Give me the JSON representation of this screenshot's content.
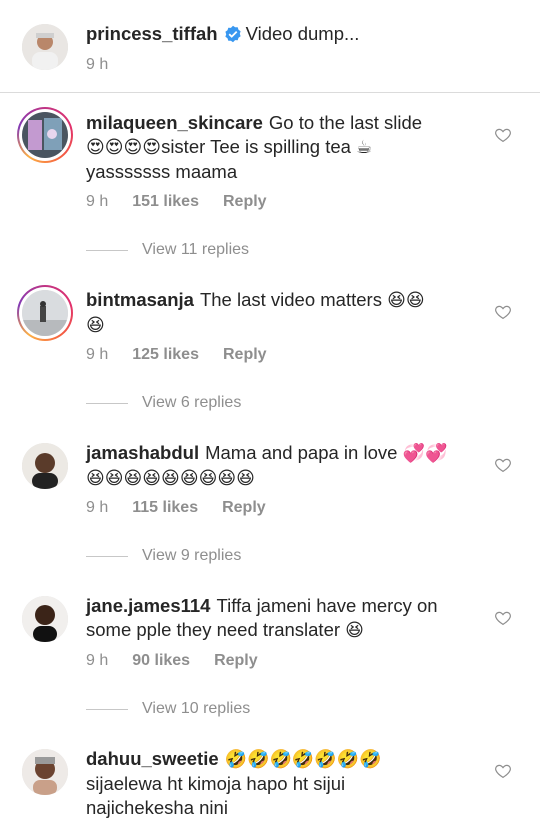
{
  "caption": {
    "username": "princess_tiffah",
    "text": "Video dump...",
    "time": "9 h"
  },
  "comments": [
    {
      "username": "milaqueen_skincare",
      "text_line1": "Go to the last slide",
      "text_line2": "sister Tee is spilling tea",
      "text_line3": "yasssssss maama",
      "emoji_a": "😍😍😍😍",
      "emoji_b": "☕",
      "time": "9 h",
      "likes": "151 likes",
      "reply": "Reply",
      "view_replies": "View 11 replies"
    },
    {
      "username": "bintmasanja",
      "text_line1": "The last video matters",
      "emoji_a": "😆😆",
      "emoji_b": "😆",
      "time": "9 h",
      "likes": "125 likes",
      "reply": "Reply",
      "view_replies": "View 6 replies"
    },
    {
      "username": "jamashabdul",
      "text_line1": "Mama and papa in love",
      "emoji_a": "💞💞",
      "emoji_b": "😆😆😆😆😆😆😆😆😆",
      "time": "9 h",
      "likes": "115 likes",
      "reply": "Reply",
      "view_replies": "View 9 replies"
    },
    {
      "username": "jane.james114",
      "text_line1": "Tiffa jameni have mercy on",
      "text_line2": "some pple they need translater",
      "emoji_a": "😆",
      "time": "9 h",
      "likes": "90 likes",
      "reply": "Reply",
      "view_replies": "View 10 replies"
    },
    {
      "username": "dahuu_sweetie",
      "emoji_a": "🤣🤣🤣🤣🤣🤣🤣",
      "text_line2": "sijaelewa ht kimoja hapo ht sijui",
      "text_line3": "najichekesha nini"
    }
  ],
  "icons": {
    "like": "heart-outline-icon",
    "verified": "verified-badge-icon"
  },
  "colors": {
    "text": "#262626",
    "secondary": "#8e8e8e",
    "verified": "#3897f0"
  }
}
